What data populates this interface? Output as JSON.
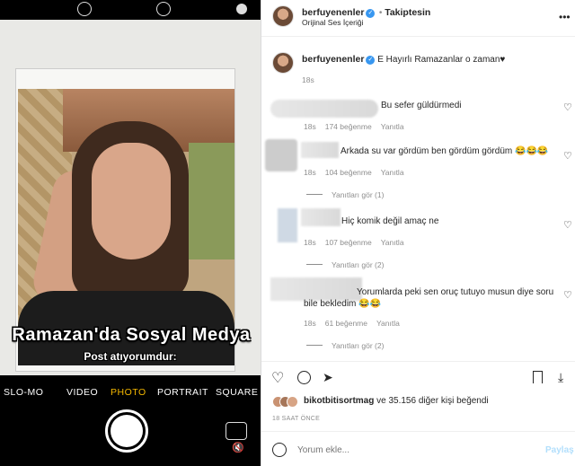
{
  "camera": {
    "caption_title": "Ramazan'da Sosyal Medya",
    "caption_sub": "Post atıyorumdur:",
    "modes": [
      "SLO-MO",
      "VIDEO",
      "PHOTO",
      "PORTRAIT",
      "SQUARE"
    ],
    "active_mode": "PHOTO",
    "accent_color": "#f5b800"
  },
  "post": {
    "username": "berfuyenenler",
    "follow_status": "Takiptesin",
    "audio": "Orijinal Ses İçeriği",
    "caption_user": "berfuyenenler",
    "caption_text": "E Hayırlı Ramazanlar o zaman♥",
    "caption_time": "18s"
  },
  "comments": [
    {
      "text": "Bu sefer güldürmedi",
      "time": "18s",
      "likes": "174 beğenme",
      "reply": "Yanıtla",
      "replies": ""
    },
    {
      "text": "Arkada su var gördüm ben gördüm gördüm 😂😂😂",
      "time": "18s",
      "likes": "104 beğenme",
      "reply": "Yanıtla",
      "replies": "Yanıtları gör (1)"
    },
    {
      "text": "Hiç komik değil amaç ne",
      "time": "18s",
      "likes": "107 beğenme",
      "reply": "Yanıtla",
      "replies": "Yanıtları gör (2)"
    },
    {
      "text_line1": "Yorumlarda peki sen oruç tutuyo musun diye soru",
      "text_line2": "bile bekledim 😂😂",
      "time": "18s",
      "likes": "61 beğenme",
      "reply": "Yanıtla",
      "replies": "Yanıtları gör (2)"
    }
  ],
  "likes": {
    "user": "bikotbitisortmag",
    "rest": "ve 35.156 diğer kişi beğendi",
    "time_ago": "18 SAAT ÖNCE"
  },
  "comment_box": {
    "placeholder": "Yorum ekle...",
    "post_label": "Paylaş"
  }
}
